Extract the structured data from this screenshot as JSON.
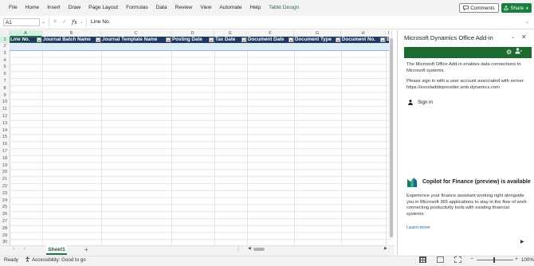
{
  "ribbon": {
    "tabs": [
      "File",
      "Home",
      "Insert",
      "Draw",
      "Page Layout",
      "Formulas",
      "Data",
      "Review",
      "View",
      "Automate",
      "Help",
      "Table Design"
    ],
    "comments_label": "Comments",
    "share_label": "Share"
  },
  "formula_bar": {
    "name_box": "A1",
    "fx": "fx",
    "value": "Line No."
  },
  "grid": {
    "column_letters": [
      "A",
      "B",
      "C",
      "D",
      "E",
      "F",
      "G",
      "H",
      "I"
    ],
    "row_numbers": [
      "1",
      "2",
      "3",
      "4",
      "5",
      "6",
      "7",
      "8",
      "9",
      "10",
      "11",
      "12",
      "13",
      "14",
      "15",
      "16",
      "17",
      "18",
      "19",
      "20",
      "21",
      "22",
      "23",
      "24",
      "25",
      "26",
      "27",
      "28",
      "29",
      "30"
    ],
    "table_headers": [
      "Line No.",
      "Journal Batch Name",
      "Journal Template Name",
      "Posting Date",
      "Tax Date",
      "Document Date",
      "Document Type",
      "Document No.",
      "E"
    ],
    "header_color": "#1f3864",
    "accent_color": "#217346"
  },
  "sheets": {
    "tabs": [
      "Sheet1"
    ],
    "add_label": "+"
  },
  "status_bar": {
    "ready": "Ready",
    "accessibility": "Accessibility: Good to go",
    "zoom": "100%"
  },
  "addin_pane": {
    "title": "Microsoft Dynamics Office Add-in",
    "header_color": "#1e6b2f",
    "intro": "The Microsoft Office Add-in enables data connections to Microsoft systems.",
    "signin_prompt": "Please sign in with a user account associated with server:",
    "server": "https://exceladdinprovider.smb.dynamics.com",
    "signin_label": "Sign in",
    "copilot_title": "Copilot for Finance (preview) is available",
    "copilot_desc": "Experience your finance assistant working right alongside you in Microsoft 365 applications to stay in the flow of work connecting productivity tools with existing financial systems.",
    "learn_more": "Learn more"
  }
}
